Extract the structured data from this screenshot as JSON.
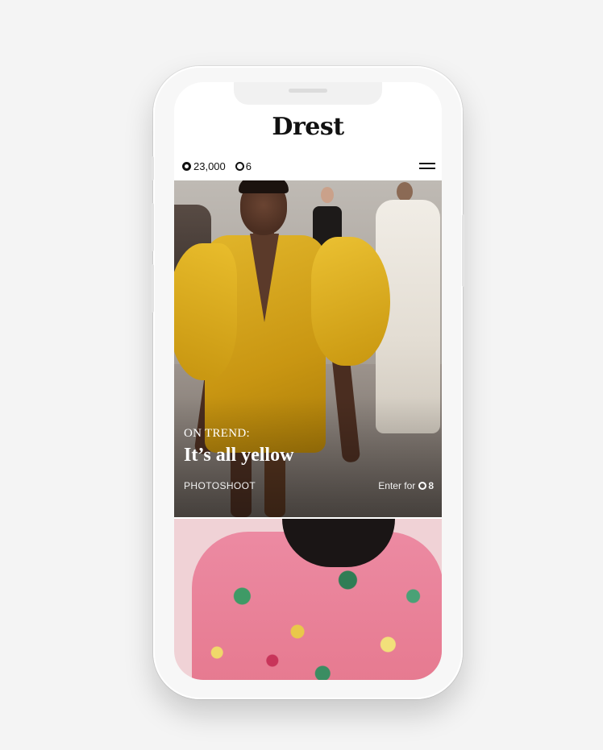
{
  "app": {
    "logo": "Drest"
  },
  "status_bar": {
    "coins": "23,000",
    "tokens": "6"
  },
  "icons": {
    "coin": "coin-icon",
    "token": "token-icon",
    "menu": "hamburger-menu-icon"
  },
  "hero_card": {
    "kicker": "ON TREND:",
    "title": "It’s all yellow",
    "category": "PHOTOSHOOT",
    "enter_label": "Enter for",
    "enter_cost": "8"
  },
  "colors": {
    "background": "#f4f4f4",
    "text": "#111111",
    "hero_text": "#ffffff",
    "dress_yellow": "#d4a51c",
    "blouse_pink": "#ec8aa2"
  }
}
